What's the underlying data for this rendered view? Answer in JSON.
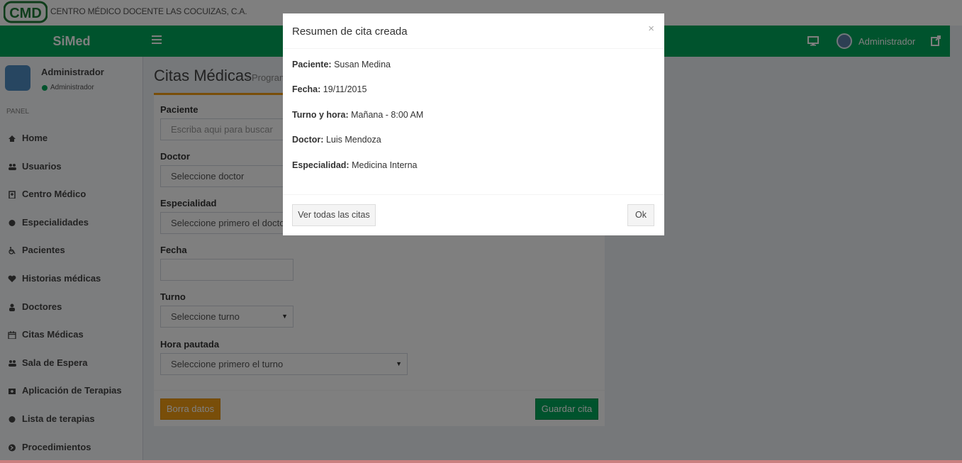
{
  "topbar": {
    "logo_text": "CMD",
    "org_name": "CENTRO MÉDICO DOCENTE LAS COCUIZAS, C.A."
  },
  "header": {
    "brand": "SiMed",
    "user_name": "Administrador",
    "brand_color": "#00a65a"
  },
  "sidebar": {
    "user_name": "Administrador",
    "user_status": "Administrador",
    "section_header": "PANEL",
    "items": [
      {
        "label": "Home",
        "icon": "home-icon"
      },
      {
        "label": "Usuarios",
        "icon": "users-icon"
      },
      {
        "label": "Centro Médico",
        "icon": "hospital-icon"
      },
      {
        "label": "Especialidades",
        "icon": "gear-icon"
      },
      {
        "label": "Pacientes",
        "icon": "wheelchair-icon"
      },
      {
        "label": "Historias médicas",
        "icon": "heartbeat-icon"
      },
      {
        "label": "Doctores",
        "icon": "user-md-icon"
      },
      {
        "label": "Citas Médicas",
        "icon": "calendar-icon"
      },
      {
        "label": "Sala de Espera",
        "icon": "users-icon"
      },
      {
        "label": "Aplicación de Terapias",
        "icon": "medkit-icon"
      },
      {
        "label": "Lista de terapias",
        "icon": "gear-icon"
      },
      {
        "label": "Procedimientos",
        "icon": "arrow-circle-icon"
      }
    ]
  },
  "content": {
    "title": "Citas Médicas",
    "subtitle": "- Program",
    "form": {
      "paciente_label": "Paciente",
      "paciente_placeholder": "Escriba aqui para buscar",
      "doctor_label": "Doctor",
      "doctor_value": "Seleccione doctor",
      "especialidad_label": "Especialidad",
      "especialidad_value": "Seleccione primero el doctor",
      "fecha_label": "Fecha",
      "fecha_value": "",
      "turno_label": "Turno",
      "turno_value": "Seleccione turno",
      "hora_label": "Hora pautada",
      "hora_value": "Seleccione primero el turno"
    },
    "buttons": {
      "clear": "Borra datos",
      "save": "Guardar cita"
    }
  },
  "modal": {
    "title": "Resumen de cita creada",
    "close": "×",
    "rows": [
      {
        "label": "Paciente:",
        "value": "Susan Medina"
      },
      {
        "label": "Fecha:",
        "value": "19/11/2015"
      },
      {
        "label": "Turno y hora:",
        "value": "Mañana - 8:00 AM"
      },
      {
        "label": "Doctor:",
        "value": "Luis Mendoza"
      },
      {
        "label": "Especialidad:",
        "value": "Medicina Interna"
      }
    ],
    "btn_all": "Ver todas las citas",
    "btn_ok": "Ok"
  }
}
